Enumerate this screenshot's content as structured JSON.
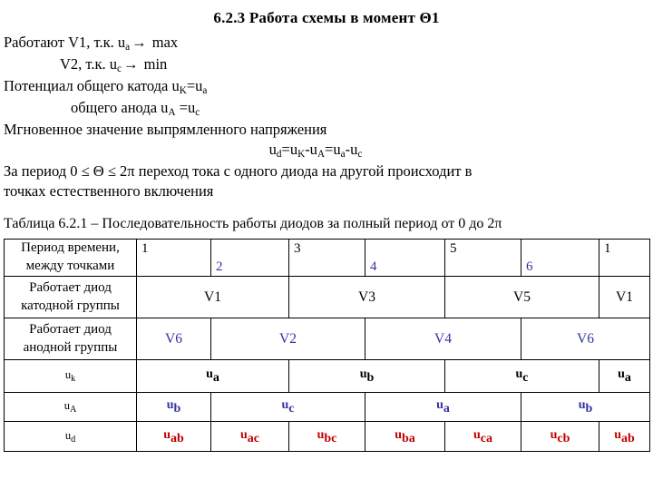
{
  "title": "6.2.3 Работа схемы в момент Θ1",
  "body": {
    "line1_a": "Работают V1, т.к. u",
    "line1_sub": "a",
    "line1_b": " max",
    "line2_a": "V2, т.к. u",
    "line2_sub": "c",
    "line2_b": " min",
    "line3_a": "Потенциал общего катода u",
    "line3_sub1": "K",
    "line3_mid": "=u",
    "line3_sub2": "a",
    "line4_a": "общего анода u",
    "line4_sub1": "A",
    "line4_mid": " =u",
    "line4_sub2": "c",
    "line5": "Мгновенное значение выпрямленного напряжения",
    "formula_a": "u",
    "formula_sub1": "d",
    "formula_b": "=u",
    "formula_sub2": "K",
    "formula_c": "-u",
    "formula_sub3": "A",
    "formula_d": "=u",
    "formula_sub4": "a",
    "formula_e": "-u",
    "formula_sub5": "c",
    "line6": "За период 0 ≤ Θ ≤ 2π переход тока с одного диода на другой происходит в",
    "line7": "точках естественного включения"
  },
  "caption": "Таблица 6.2.1 – Последовательность работы диодов за полный период от 0 до 2π",
  "table": {
    "row_labels": {
      "period_l1": "Период времени,",
      "period_l2": "между точками",
      "cathode_l1": "Работает диод",
      "cathode_l2": "катодной группы",
      "anode_l1": "Работает диод",
      "anode_l2": "анодной группы",
      "uk_a": "u",
      "uk_sub": "k",
      "uA_a": "u",
      "uA_sub": "A",
      "ud_a": "u",
      "ud_sub": "d"
    },
    "period_numbers": [
      "1",
      "2",
      "3",
      "4",
      "5",
      "6",
      "1"
    ],
    "cathode_diodes": [
      "V1",
      "V3",
      "V5",
      "V1"
    ],
    "anode_diodes": [
      "V6",
      "V2",
      "V4",
      "V6"
    ],
    "uk_values": [
      {
        "base": "u",
        "sub": "a"
      },
      {
        "base": "u",
        "sub": "b"
      },
      {
        "base": "u",
        "sub": "c"
      },
      {
        "base": "u",
        "sub": "a"
      }
    ],
    "uA_values": [
      {
        "base": "u",
        "sub": "b"
      },
      {
        "base": "u",
        "sub": "c"
      },
      {
        "base": "u",
        "sub": "a"
      },
      {
        "base": "u",
        "sub": "b"
      }
    ],
    "ud_values": [
      {
        "base": "u",
        "sub": "ab"
      },
      {
        "base": "u",
        "sub": "ac"
      },
      {
        "base": "u",
        "sub": "bc"
      },
      {
        "base": "u",
        "sub": "ba"
      },
      {
        "base": "u",
        "sub": "ca"
      },
      {
        "base": "u",
        "sub": "cb"
      },
      {
        "base": "u",
        "sub": "ab"
      }
    ]
  },
  "colors": {
    "black": "#000000",
    "blue": "#3333a0",
    "red": "#c00000"
  }
}
